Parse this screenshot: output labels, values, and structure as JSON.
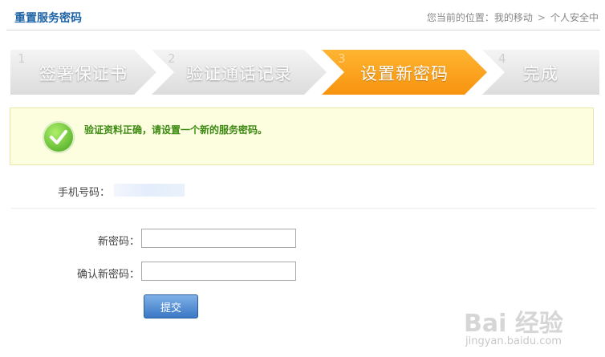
{
  "header": {
    "title": "重置服务密码",
    "breadcrumb_prefix": "您当前的位置：",
    "breadcrumb_items": [
      "我的移动",
      "个人安全中"
    ],
    "breadcrumb_sep": ">"
  },
  "steps": [
    {
      "num": "1",
      "label": "签署保证书",
      "active": false
    },
    {
      "num": "2",
      "label": "验证通话记录",
      "active": false
    },
    {
      "num": "3",
      "label": "设置新密码",
      "active": true
    },
    {
      "num": "4",
      "label": "完成",
      "active": false
    }
  ],
  "notice": {
    "text": "验证资料正确，请设置一个新的服务密码。",
    "icon": "check-circle-icon"
  },
  "phone": {
    "label": "手机号码："
  },
  "form": {
    "new_password_label": "新密码：",
    "confirm_password_label": "确认新密码：",
    "new_password_value": "",
    "confirm_password_value": "",
    "submit_label": "提交"
  },
  "watermark": {
    "main": "Bai 经验",
    "sub": "jingyan.baidu.com"
  },
  "colors": {
    "accent_orange": "#f7930e",
    "title_blue": "#1d63a6",
    "success_green": "#3d8b12",
    "notice_bg": "#fdfde0"
  }
}
